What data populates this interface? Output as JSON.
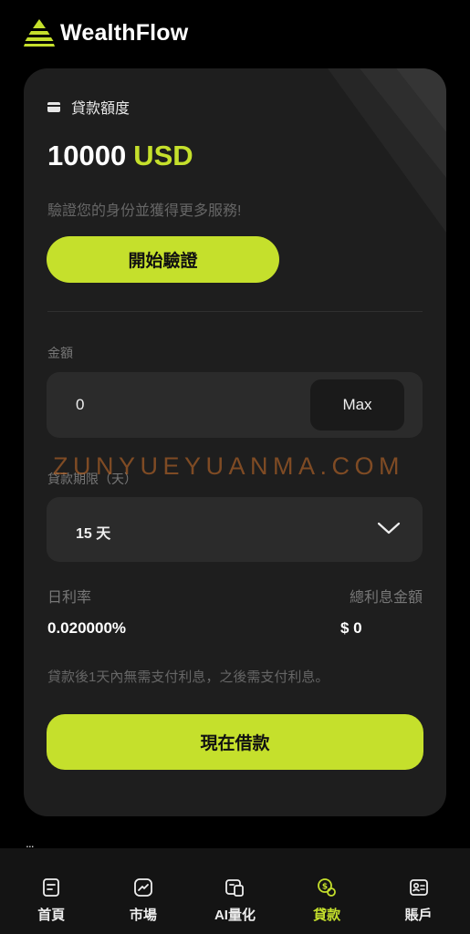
{
  "brand": {
    "name": "WealthFlow"
  },
  "colors": {
    "accent": "#c5e02c",
    "background": "#000000",
    "card": "#1e1e1e",
    "field": "#2b2b2b"
  },
  "loan": {
    "limit_label": "貸款額度",
    "limit_amount": "10000",
    "limit_currency": "USD",
    "verify_hint": "驗證您的身份並獲得更多服務!",
    "verify_button": "開始驗證",
    "amount_label": "金額",
    "amount_value": "0",
    "max_button": "Max",
    "term_label": "貸款期限（天）",
    "term_value": "15 天",
    "daily_rate_label": "日利率",
    "daily_rate_value": "0.020000%",
    "total_interest_label": "總利息金額",
    "total_interest_value": "$ 0",
    "note": "貸款後1天內無需支付利息，之後需支付利息。",
    "borrow_button": "現在借款"
  },
  "watermark": "ZUNYUEYUANMA.COM",
  "more_indicator": "...",
  "nav": {
    "items": [
      {
        "label": "首頁",
        "icon": "home-icon",
        "active": false
      },
      {
        "label": "市場",
        "icon": "market-icon",
        "active": false
      },
      {
        "label": "AI量化",
        "icon": "ai-quant-icon",
        "active": false
      },
      {
        "label": "貸款",
        "icon": "loan-icon",
        "active": true
      },
      {
        "label": "賬戶",
        "icon": "account-icon",
        "active": false
      }
    ]
  }
}
